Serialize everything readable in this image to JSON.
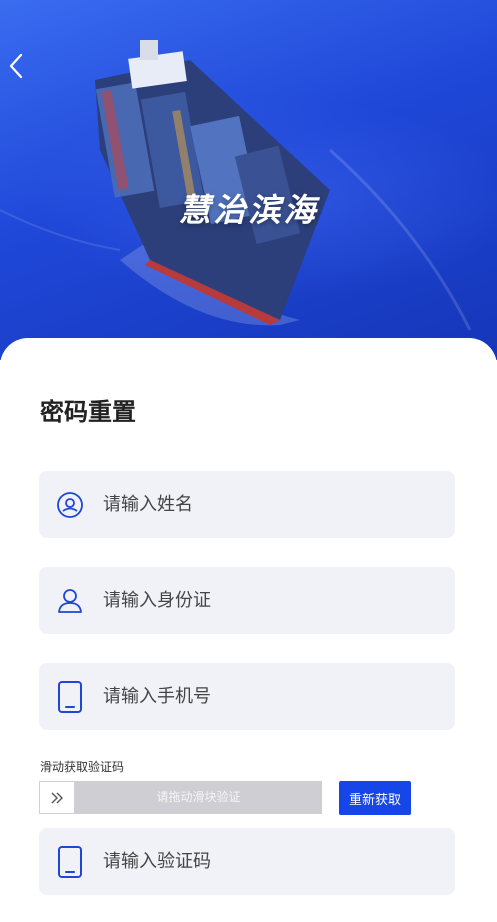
{
  "hero": {
    "title": "慧治滨海"
  },
  "form": {
    "title": "密码重置",
    "name_placeholder": "请输入姓名",
    "id_placeholder": "请输入身份证",
    "phone_placeholder": "请输入手机号",
    "code_placeholder": "请输入验证码"
  },
  "slider": {
    "label": "滑动获取验证码",
    "hint": "请拖动滑块验证",
    "refresh_label": "重新获取"
  },
  "colors": {
    "accent": "#1746e8",
    "field_bg": "#f1f2f8",
    "icon_blue": "#1f46d6"
  }
}
